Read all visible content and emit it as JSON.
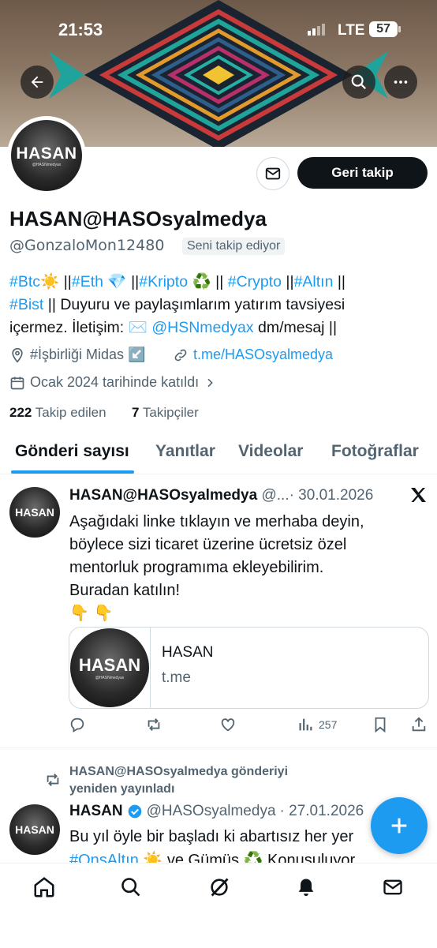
{
  "status_bar": {
    "time": "21:53",
    "network": "LTE",
    "battery": "57"
  },
  "profile": {
    "avatar_text": "HASAN",
    "avatar_sub": "@HASNmedyax",
    "display_name": "HASAN@HASOsyalmedya",
    "handle": "@GonzaloMon12480",
    "follows_you_badge": "Seni takip ediyor",
    "follow_button_label": "Geri takip",
    "bio": {
      "line1_parts": [
        "#Btc",
        "☀️",
        " ||",
        "#Eth",
        " 💎 ||",
        "#Kripto",
        " ♻️ || ",
        "#Crypto",
        " ||",
        "#Altın",
        " ||"
      ],
      "line2_tag": "#Bist",
      "line2_text": " || Duyuru ve paylaşımlarım yatırım tavsiyesi",
      "line3_text": "içermez. İletişim: ✉️ ",
      "line3_mention": "@HSNmedyax",
      "line3_end": " dm/mesaj ||"
    },
    "location": "#İşbirliği Midas ↙️",
    "link": "t.me/HASOsyalmedya",
    "joined": "Ocak 2024 tarihinde katıldı",
    "following_count": "222",
    "following_label": "Takip edilen",
    "followers_count": "7",
    "followers_label": "Takipçiler"
  },
  "tabs": [
    {
      "label": "Gönderi sayısı",
      "active": true
    },
    {
      "label": "Yanıtlar",
      "active": false
    },
    {
      "label": "Videolar",
      "active": false
    },
    {
      "label": "Fotoğraflar",
      "active": false
    }
  ],
  "post1": {
    "author": "HASAN@HASOsyalmedya",
    "handle": "@...",
    "date": "· 30.01.2026",
    "text_lines": [
      "Aşağıdaki linke tıklayın ve merhaba deyin,",
      "böylece sizi ticaret üzerine ücretsiz özel",
      "mentorluk programıma ekleyebilirim.",
      "Buradan katılın!",
      "👇 👇"
    ],
    "card_title": "HASAN",
    "card_domain": "t.me",
    "views": "257"
  },
  "post2": {
    "repost_line1": "HASAN@HASOsyalmedya gönderiyi",
    "repost_line2": "yeniden yayınladı",
    "author": "HASAN",
    "handle": "@HASOsyalmedya",
    "date": "· 27.01.2026",
    "text_line1": "Bu yıl öyle bir başladı ki abartısız her yer",
    "text_line2_tag": "#OnsAltın",
    "text_line2_rest": " ☀️  ve Gümüş ♻️  Konuşuluyor."
  },
  "colors": {
    "accent": "#1d9bf0",
    "text": "#0f1419",
    "muted": "#536471",
    "button_dark": "#0f1419"
  },
  "icons": [
    "back-arrow-icon",
    "search-icon",
    "more-icon",
    "mail-icon",
    "location-icon",
    "link-icon",
    "calendar-icon",
    "chevron-right-icon",
    "x-logo-icon",
    "reply-icon",
    "repost-icon",
    "like-icon",
    "views-icon",
    "bookmark-icon",
    "share-icon",
    "verified-icon",
    "plus-icon",
    "home-icon",
    "grok-icon",
    "notifications-icon",
    "messages-icon"
  ]
}
